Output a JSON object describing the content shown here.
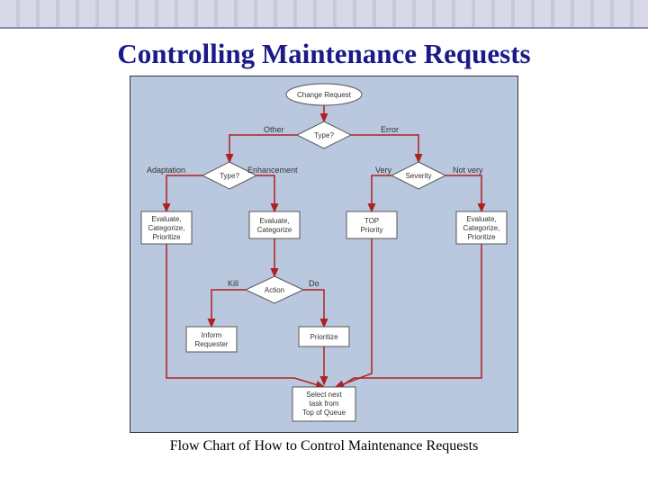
{
  "title": "Controlling Maintenance Requests",
  "caption": "Flow Chart of How to Control Maintenance Requests",
  "nodes": {
    "start": "Change Request",
    "type1": "Type?",
    "type2": "Type?",
    "severity": "Severity",
    "eval1": "Evaluate, Categorize, Prioritize",
    "eval2": "Evaluate, Categorize",
    "top": "TOP Priority",
    "eval3": "Evaluate, Categorize, Prioritize",
    "action": "Action",
    "inform": "Inform Requester",
    "prioritize": "Prioritize",
    "select": "Select next task from Top of Queue"
  },
  "edges": {
    "other": "Other",
    "error": "Error",
    "adaptation": "Adaptation",
    "enhancement": "Enhancement",
    "very": "Very",
    "notvery": "Not very",
    "kill": "Kill",
    "do": "Do"
  }
}
